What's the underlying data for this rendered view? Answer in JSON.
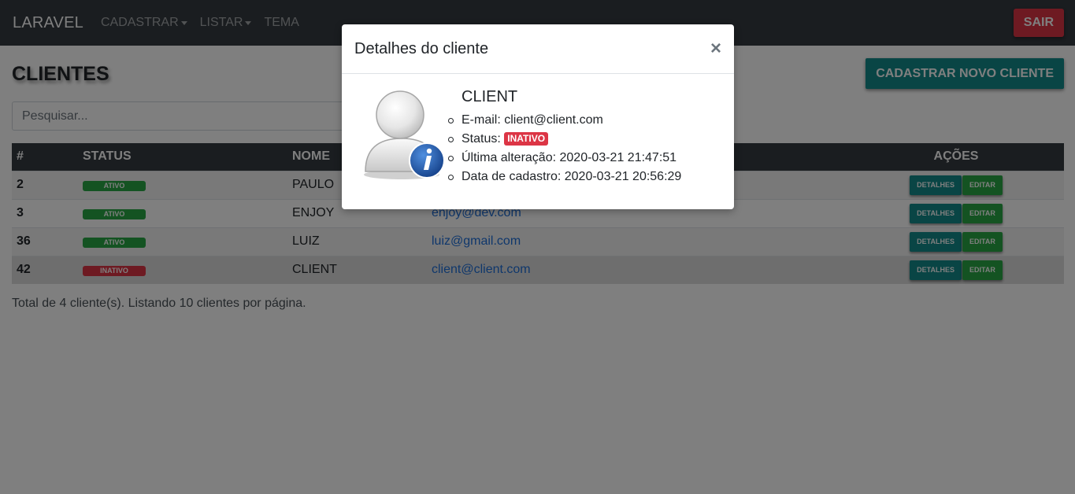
{
  "navbar": {
    "brand": "LARAVEL",
    "items": [
      {
        "label": "CADASTRAR",
        "dropdown": true
      },
      {
        "label": "LISTAR",
        "dropdown": true
      },
      {
        "label": "TEMA",
        "dropdown": false
      }
    ],
    "logout_label": "SAIR"
  },
  "page": {
    "title": "CLIENTES",
    "new_client_label": "CADASTRAR NOVO CLIENTE",
    "search_placeholder": "Pesquisar...",
    "footer": "Total de 4 cliente(s). Listando 10 clientes por página."
  },
  "table": {
    "headers": {
      "id": "#",
      "status": "STATUS",
      "nome": "NOME",
      "email": "",
      "acoes": "AÇÕES"
    },
    "action_details": "DETALHES",
    "action_edit": "EDITAR",
    "rows": [
      {
        "id": "2",
        "status": "ATIVO",
        "nome": "PAULO",
        "email": ""
      },
      {
        "id": "3",
        "status": "ATIVO",
        "nome": "ENJOY",
        "email": "enjoy@dev.com"
      },
      {
        "id": "36",
        "status": "ATIVO",
        "nome": "LUIZ",
        "email": "luiz@gmail.com"
      },
      {
        "id": "42",
        "status": "INATIVO",
        "nome": "CLIENT",
        "email": "client@client.com"
      }
    ]
  },
  "modal": {
    "title": "Detalhes do cliente",
    "close": "×",
    "avatar_icon": "user-info-icon",
    "client_name": "CLIENT",
    "email_label": "E-mail:",
    "email_value": "client@client.com",
    "status_label": "Status:",
    "status_value": "INATIVO",
    "updated_label": "Última alteração:",
    "updated_value": "2020-03-21 21:47:51",
    "created_label": "Data de cadastro:",
    "created_value": "2020-03-21 20:56:29"
  },
  "colors": {
    "navbar": "#343a40",
    "danger": "#dc3545",
    "success": "#28a745",
    "teal": "#138a8a",
    "link": "#1e6fd9"
  }
}
